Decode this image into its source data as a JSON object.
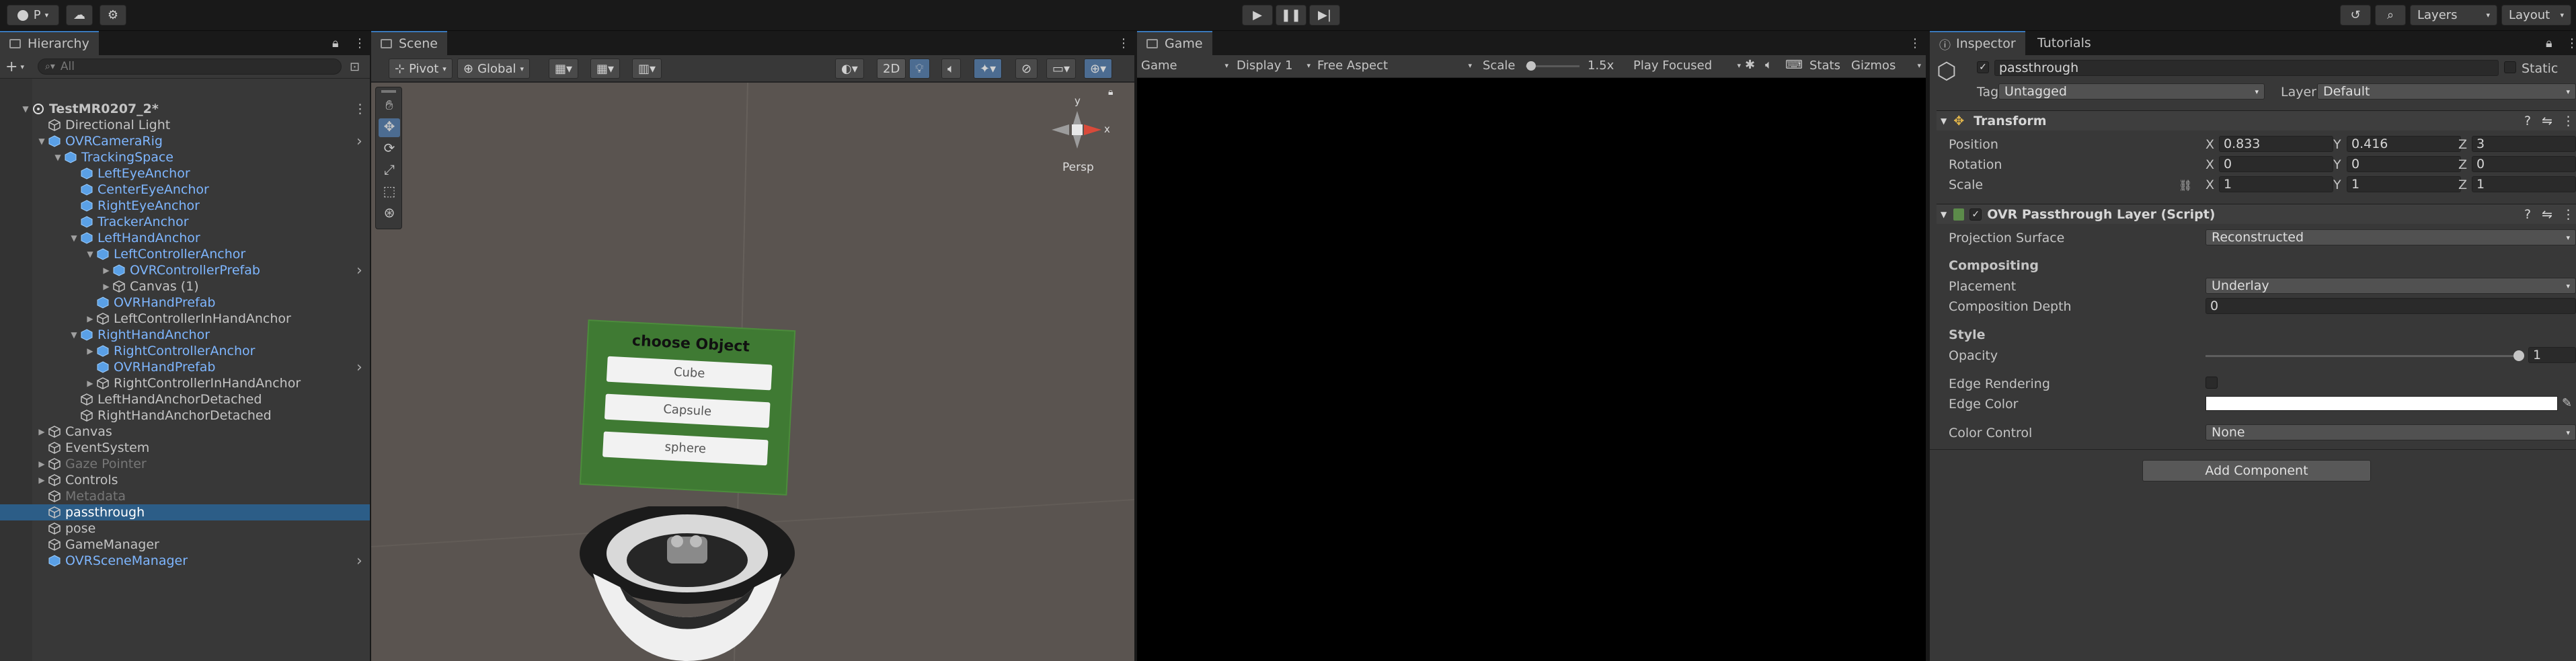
{
  "toolbar": {
    "account_label": "P",
    "layers_label": "Layers",
    "layout_label": "Layout"
  },
  "hierarchy": {
    "tab_label": "Hierarchy",
    "search_placeholder": "All",
    "items": [
      {
        "label": "TestMR0207_2*",
        "depth": 0,
        "style": "scene"
      },
      {
        "label": "Directional Light",
        "depth": 1,
        "style": "normal"
      },
      {
        "label": "OVRCameraRig",
        "depth": 1,
        "style": "prefab"
      },
      {
        "label": "TrackingSpace",
        "depth": 2,
        "style": "prefab"
      },
      {
        "label": "LeftEyeAnchor",
        "depth": 3,
        "style": "prefab"
      },
      {
        "label": "CenterEyeAnchor",
        "depth": 3,
        "style": "prefab"
      },
      {
        "label": "RightEyeAnchor",
        "depth": 3,
        "style": "prefab"
      },
      {
        "label": "TrackerAnchor",
        "depth": 3,
        "style": "prefab"
      },
      {
        "label": "LeftHandAnchor",
        "depth": 3,
        "style": "prefab"
      },
      {
        "label": "LeftControllerAnchor",
        "depth": 4,
        "style": "prefab"
      },
      {
        "label": "OVRControllerPrefab",
        "depth": 5,
        "style": "prefab"
      },
      {
        "label": "Canvas (1)",
        "depth": 5,
        "style": "normal"
      },
      {
        "label": "OVRHandPrefab",
        "depth": 4,
        "style": "prefab"
      },
      {
        "label": "LeftControllerInHandAnchor",
        "depth": 4,
        "style": "normal"
      },
      {
        "label": "RightHandAnchor",
        "depth": 3,
        "style": "prefab"
      },
      {
        "label": "RightControllerAnchor",
        "depth": 4,
        "style": "prefab"
      },
      {
        "label": "OVRHandPrefab",
        "depth": 4,
        "style": "prefab"
      },
      {
        "label": "RightControllerInHandAnchor",
        "depth": 4,
        "style": "normal"
      },
      {
        "label": "LeftHandAnchorDetached",
        "depth": 3,
        "style": "normal"
      },
      {
        "label": "RightHandAnchorDetached",
        "depth": 3,
        "style": "normal"
      },
      {
        "label": "Canvas",
        "depth": 1,
        "style": "normal"
      },
      {
        "label": "EventSystem",
        "depth": 1,
        "style": "normal"
      },
      {
        "label": "Gaze Pointer",
        "depth": 1,
        "style": "disabled"
      },
      {
        "label": "Controls",
        "depth": 1,
        "style": "normal"
      },
      {
        "label": "Metadata",
        "depth": 1,
        "style": "disabled"
      },
      {
        "label": "passthrough",
        "depth": 1,
        "style": "selected"
      },
      {
        "label": "pose",
        "depth": 1,
        "style": "normal"
      },
      {
        "label": "GameManager",
        "depth": 1,
        "style": "normal"
      },
      {
        "label": "OVRSceneManager",
        "depth": 1,
        "style": "prefab"
      }
    ]
  },
  "scene": {
    "tab_label": "Scene",
    "pivot_label": "Pivot",
    "global_label": "Global",
    "twod_label": "2D",
    "persp_label": "Persp",
    "axis_x": "x",
    "axis_y": "y",
    "ui_panel": {
      "title": "choose Object",
      "buttons": [
        "Cube",
        "Capsule",
        "sphere"
      ]
    }
  },
  "game": {
    "tab_label": "Game",
    "mode": "Game",
    "display": "Display 1",
    "aspect": "Free Aspect",
    "scale_label": "Scale",
    "scale_value": "1.5x",
    "scale_fraction": 0.1,
    "play_focused": "Play Focused",
    "stats_label": "Stats",
    "gizmos_label": "Gizmos"
  },
  "inspector": {
    "tab_label": "Inspector",
    "tutorials_label": "Tutorials",
    "object_name": "passthrough",
    "static_label": "Static",
    "tag_label": "Tag",
    "tag_value": "Untagged",
    "layer_label": "Layer",
    "layer_value": "Default",
    "transform": {
      "header": "Transform",
      "position_label": "Position",
      "rotation_label": "Rotation",
      "scale_label": "Scale",
      "position": {
        "x": "0.833",
        "y": "0.416",
        "z": "3"
      },
      "rotation": {
        "x": "0",
        "y": "0",
        "z": "0"
      },
      "scale": {
        "x": "1",
        "y": "1",
        "z": "1"
      }
    },
    "passthrough": {
      "header": "OVR Passthrough Layer (Script)",
      "projection_label": "Projection Surface",
      "projection_value": "Reconstructed",
      "compositing_label": "Compositing",
      "placement_label": "Placement",
      "placement_value": "Underlay",
      "depth_label": "Composition Depth",
      "depth_value": "0",
      "style_label": "Style",
      "opacity_label": "Opacity",
      "opacity_value": "1",
      "opacity_fraction": 1.0,
      "edge_rendering_label": "Edge Rendering",
      "edge_color_label": "Edge Color",
      "color_control_label": "Color Control",
      "color_control_value": "None"
    },
    "add_component_label": "Add Component"
  },
  "colors": {
    "selection": "#2c5d87",
    "accent_tab": "#3a79bb",
    "prefab_text": "#7eb6ff",
    "ui_panel_green": "#3f7a33",
    "scene_ground": "#5a5450"
  }
}
